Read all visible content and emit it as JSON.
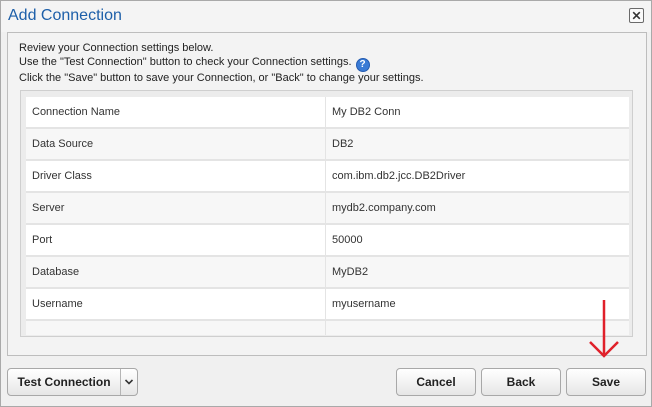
{
  "dialog": {
    "title": "Add Connection",
    "close_icon": "close-icon"
  },
  "instructions": {
    "line1": "Review your Connection settings below.",
    "line2": "Use the \"Test Connection\" button to check your Connection settings.",
    "line3": "Click the \"Save\" button to save your Connection, or \"Back\" to change your settings.",
    "help_icon": "help-icon"
  },
  "settings": [
    {
      "key": "Connection Name",
      "value": "My DB2 Conn"
    },
    {
      "key": "Data Source",
      "value": "DB2"
    },
    {
      "key": "Driver Class",
      "value": "com.ibm.db2.jcc.DB2Driver"
    },
    {
      "key": "Server",
      "value": "mydb2.company.com"
    },
    {
      "key": "Port",
      "value": "50000"
    },
    {
      "key": "Database",
      "value": "MyDB2"
    },
    {
      "key": "Username",
      "value": "myusername"
    }
  ],
  "footer": {
    "test_connection": "Test Connection",
    "cancel": "Cancel",
    "back": "Back",
    "save": "Save"
  },
  "colors": {
    "title": "#1d5fa9",
    "annotation_arrow": "#e0202a",
    "help_icon": "#3a7bd5"
  }
}
